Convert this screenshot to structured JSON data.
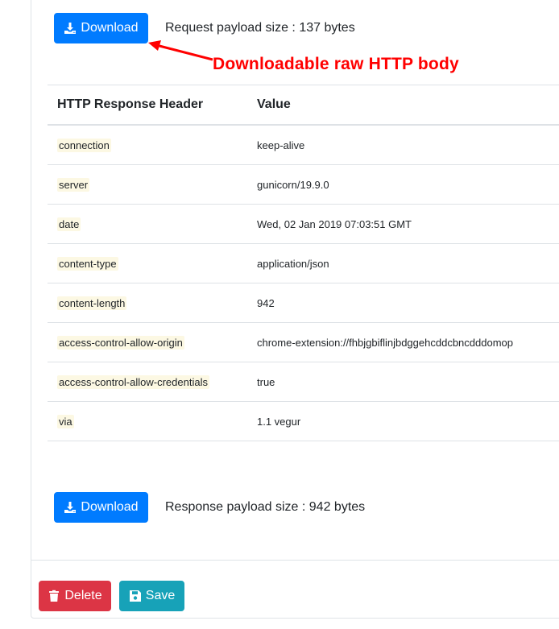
{
  "request": {
    "download_label": "Download",
    "payload_text": "Request payload size : 137 bytes"
  },
  "annotation": {
    "text": "Downloadable raw HTTP body",
    "color": "#ff0000"
  },
  "headers_table": {
    "columns": [
      "HTTP Response Header",
      "Value"
    ],
    "rows": [
      {
        "name": "connection",
        "value": "keep-alive"
      },
      {
        "name": "server",
        "value": "gunicorn/19.9.0"
      },
      {
        "name": "date",
        "value": "Wed, 02 Jan 2019 07:03:51 GMT"
      },
      {
        "name": "content-type",
        "value": "application/json"
      },
      {
        "name": "content-length",
        "value": "942"
      },
      {
        "name": "access-control-allow-origin",
        "value": "chrome-extension://fhbjgbiflinjbdggehcddcbncdddomop"
      },
      {
        "name": "access-control-allow-credentials",
        "value": "true"
      },
      {
        "name": "via",
        "value": "1.1 vegur"
      }
    ]
  },
  "response": {
    "download_label": "Download",
    "payload_text": "Response payload size : 942 bytes"
  },
  "actions": {
    "delete_label": "Delete",
    "save_label": "Save"
  },
  "colors": {
    "primary": "#007bff",
    "danger": "#dc3545",
    "info": "#17a2b8",
    "highlight": "#fcf8e3"
  },
  "icons": {
    "download": "download-icon",
    "trash": "trash-icon",
    "save": "floppy-disk-icon"
  }
}
